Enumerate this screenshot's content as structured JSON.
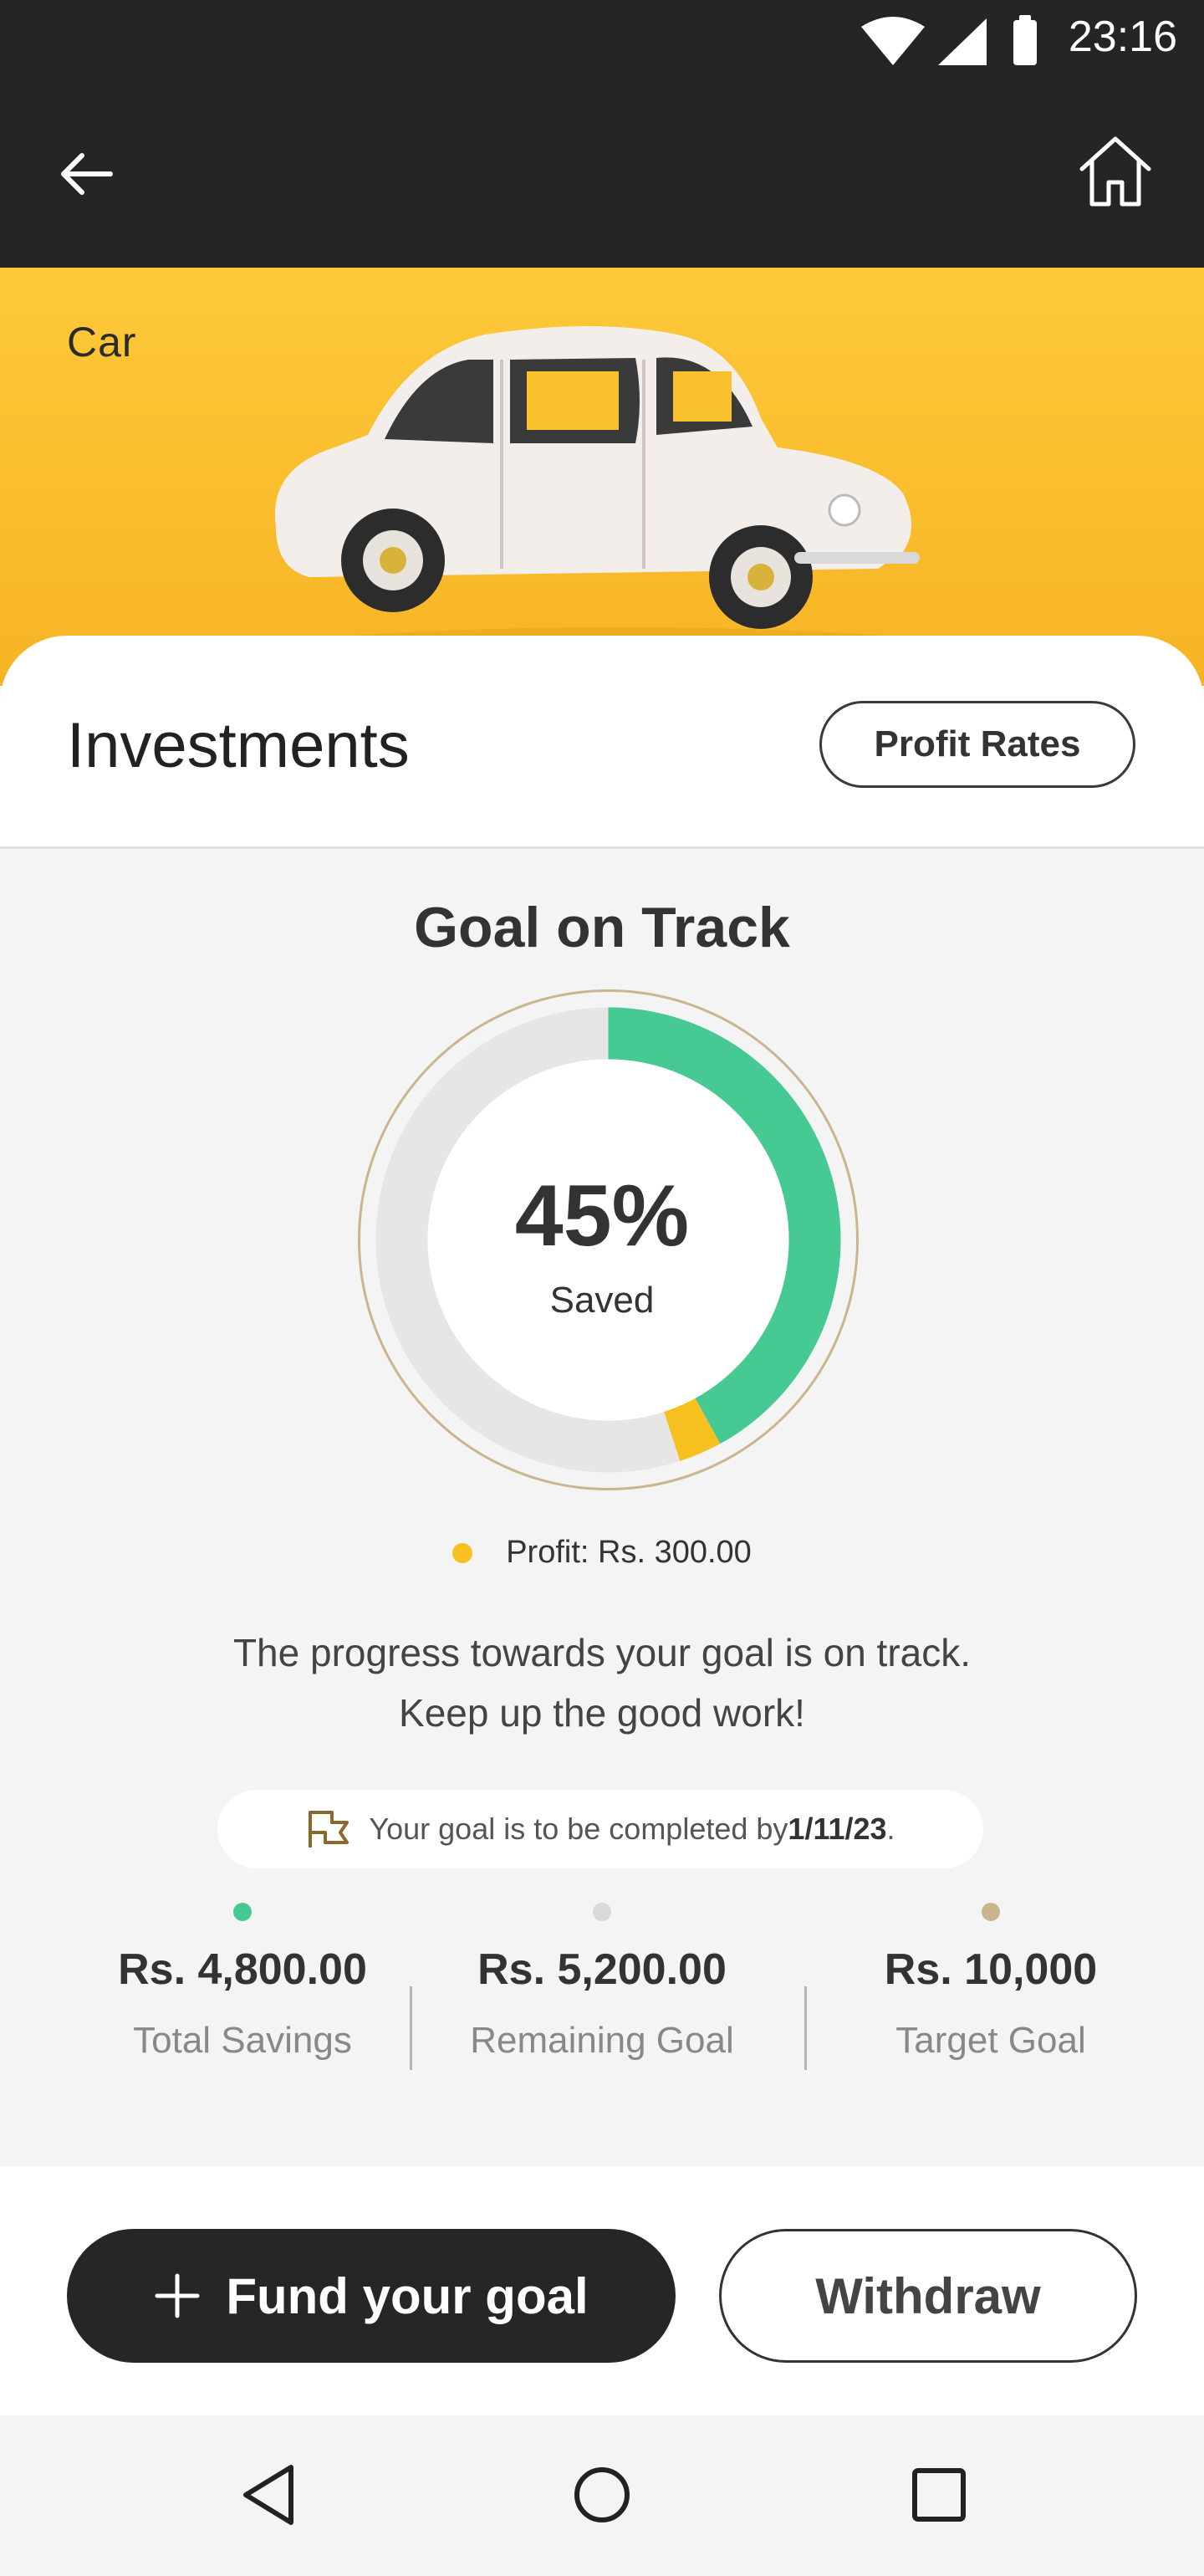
{
  "status_bar": {
    "time": "23:16",
    "icons": [
      "wifi-icon",
      "signal-icon",
      "battery-icon"
    ]
  },
  "app_bar": {
    "back_icon": "arrow-left-icon",
    "home_icon": "home-icon"
  },
  "hero": {
    "title": "Car",
    "background_color": "#f9bc2c"
  },
  "investments": {
    "title": "Investments",
    "profit_rates_label": "Profit Rates"
  },
  "goal": {
    "status": "Goal on Track",
    "percent_label": "45%",
    "saved_label": "Saved",
    "saved_fraction": 0.42,
    "profit_fraction": 0.03,
    "colors": {
      "savings": "#47c993",
      "profit": "#f6c021",
      "track": "#e6e6e6",
      "ring": "#cbb58f"
    },
    "profit_text": "Profit: Rs. 300.00",
    "message_line1": "The progress towards your goal is on track.",
    "message_line2": "Keep up the good work!",
    "deadline_text": "Your goal is to be completed by ",
    "deadline_date": "1/11/23",
    "deadline_suffix": "."
  },
  "stats": [
    {
      "value": "Rs. 4,800.00",
      "label": "Total Savings",
      "dot_color": "#47c993"
    },
    {
      "value": "Rs. 5,200.00",
      "label": "Remaining Goal",
      "dot_color": "#d9d9d9"
    },
    {
      "value": "Rs. 10,000",
      "label": "Target Goal",
      "dot_color": "#cbb58f"
    }
  ],
  "actions": {
    "fund_label": "Fund your goal",
    "withdraw_label": "Withdraw"
  },
  "nav": {
    "icons": [
      "back-triangle-icon",
      "home-circle-icon",
      "recents-square-icon"
    ]
  }
}
